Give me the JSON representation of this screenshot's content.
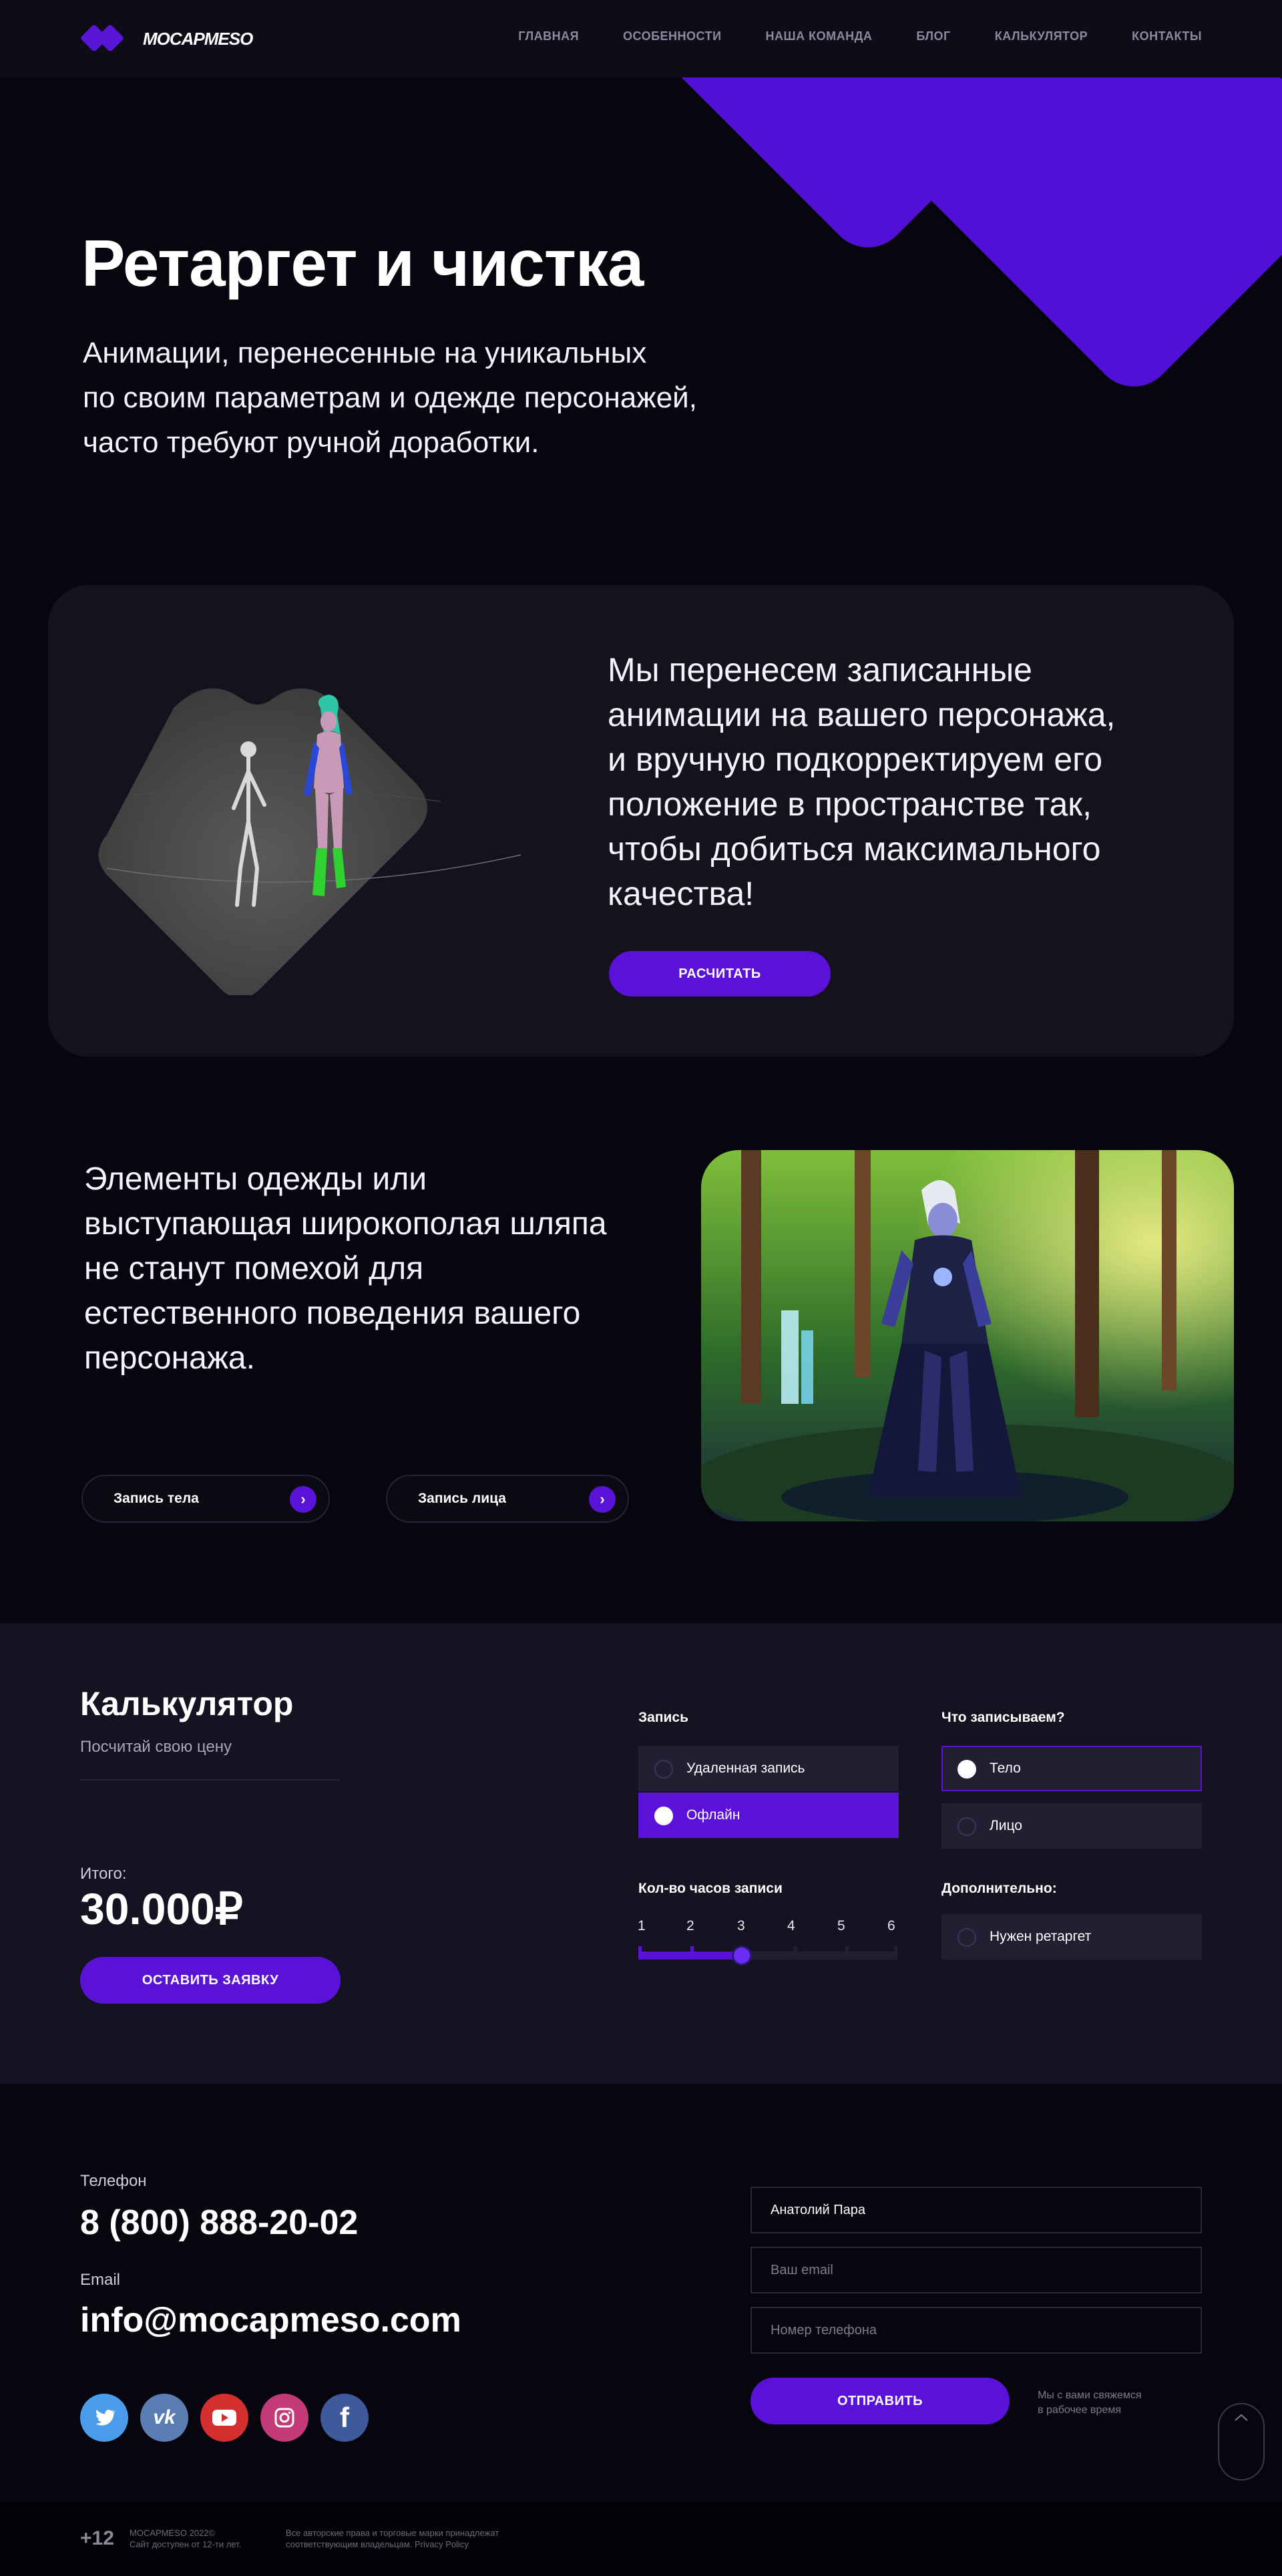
{
  "header": {
    "logo_text": "MOCAPMESO",
    "nav": [
      "ГЛАВНАЯ",
      "ОСОБЕННОСТИ",
      "НАША КОМАНДА",
      "БЛОГ",
      "КАЛЬКУЛЯТОР",
      "КОНТАКТЫ"
    ]
  },
  "hero": {
    "title": "Ретаргет и чистка",
    "subtitle": "Анимации, перенесенные на уникальных\nпо своим параметрам и одежде персонажей,\nчасто требуют ручной доработки."
  },
  "feature": {
    "text": "Мы перенесем записанные\nанимации на вашего персонажа,\nи вручную подкорректируем его\nположение в пространстве так,\nчтобы добиться максимального\nкачества!",
    "button": "РАСЧИТАТЬ"
  },
  "clothing": {
    "text": "Элементы одежды или\nвыступающая широкополая шляпа\nне станут помехой для\nестественного поведения вашего\nперсонажа.",
    "pill_body": "Запись тела",
    "pill_face": "Запись лица"
  },
  "calculator": {
    "title": "Калькулятор",
    "subtitle": "Посчитай свою цену",
    "total_label": "Итого:",
    "total_value": "30.000₽",
    "submit": "ОСТАВИТЬ ЗАЯВКУ",
    "record_label": "Запись",
    "record_options": [
      "Удаленная запись",
      "Офлайн"
    ],
    "record_selected": 1,
    "what_label": "Что записываем?",
    "what_options": [
      "Тело",
      "Лицо"
    ],
    "what_selected": 0,
    "hours_label": "Кол-во часов записи",
    "hours_ticks": [
      "1",
      "2",
      "3",
      "4",
      "5",
      "6"
    ],
    "hours_value": 3,
    "extra_label": "Дополнительно:",
    "extra_option": "Нужен ретаргет",
    "extra_checked": false
  },
  "contacts": {
    "phone_label": "Телефон",
    "phone": "8 (800) 888-20-02",
    "email_label": "Email",
    "email": "info@mocapmeso.com",
    "socials": [
      "twitter-icon",
      "vk-icon",
      "youtube-icon",
      "instagram-icon",
      "facebook-icon"
    ],
    "form": {
      "name_value": "Анатолий Пара",
      "email_placeholder": "Ваш email",
      "phone_placeholder": "Номер телефона",
      "submit": "ОТПРАВИТЬ",
      "note": "Мы с вами свяжемся\nв рабочее время"
    }
  },
  "footer": {
    "age": "+12",
    "copyright": "MOCAPMESO 2022©\nСайт доступен от 12-ти лет.",
    "rights": "Все авторские права и торговые марки принадлежат\nсоответствующим владельцам. Privacy Policy"
  },
  "colors": {
    "accent": "#5a12d8",
    "background": "#07060e",
    "panel": "#151321"
  }
}
